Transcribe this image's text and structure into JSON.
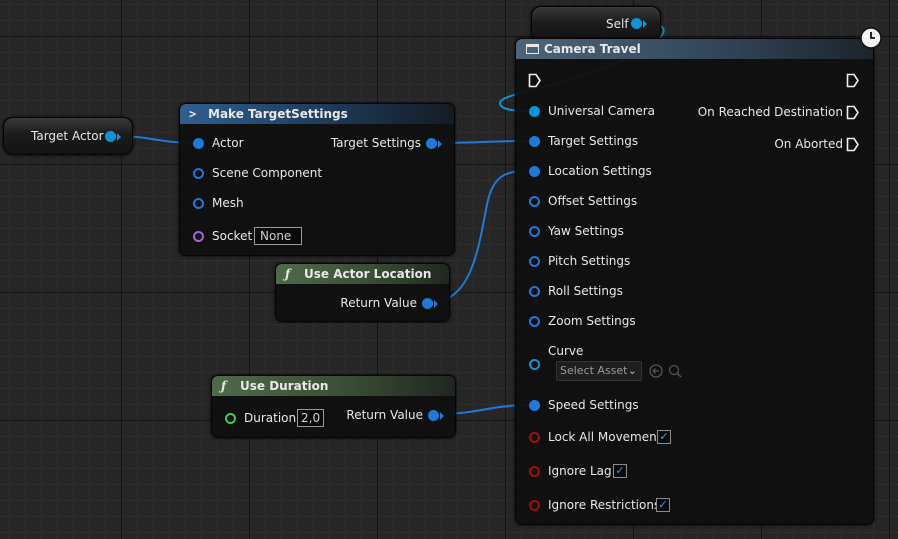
{
  "self_node": {
    "label": "Self"
  },
  "target_actor_node": {
    "label": "Target Actor"
  },
  "make_target_settings": {
    "title": "Make TargetSettings",
    "inputs": {
      "actor": "Actor",
      "scene_component": "Scene Component",
      "mesh": "Mesh",
      "socket": "Socket",
      "socket_value": "None"
    },
    "output": "Target Settings"
  },
  "use_actor_location": {
    "title": "Use Actor Location",
    "output": "Return Value"
  },
  "use_duration": {
    "title": "Use Duration",
    "input_label": "Duration",
    "input_value": "2,0",
    "output": "Return Value"
  },
  "camera_travel": {
    "title": "Camera Travel",
    "inputs": {
      "universal_camera": "Universal Camera",
      "target_settings": "Target Settings",
      "location_settings": "Location Settings",
      "offset_settings": "Offset Settings",
      "yaw_settings": "Yaw Settings",
      "pitch_settings": "Pitch Settings",
      "roll_settings": "Roll Settings",
      "zoom_settings": "Zoom Settings",
      "curve": "Curve",
      "curve_select": "Select Asset",
      "speed_settings": "Speed Settings",
      "lock_all_movement": "Lock All Movement",
      "ignore_lag": "Ignore Lag",
      "ignore_restrictions": "Ignore Restrictions"
    },
    "checkboxes": {
      "lock_all_movement": true,
      "ignore_lag": true,
      "ignore_restrictions": true
    },
    "outputs": {
      "on_reached_destination": "On Reached Destination",
      "on_aborted": "On Aborted"
    }
  },
  "colors": {
    "struct_pin": "#1f7ad6",
    "object_pin": "#0d94d8",
    "class_pin": "#a860e0",
    "float_pin": "#3fcf48",
    "bool_pin": "#9a1212",
    "function_header": "#4f6a48",
    "make_struct_header": "#2f5f8f",
    "checkbox_tick": "#3a9cf0"
  },
  "icons": {
    "latent_node": "clock-icon",
    "function": "function-icon",
    "make_struct": "make-struct-icon",
    "camera_travel": "window-icon"
  }
}
